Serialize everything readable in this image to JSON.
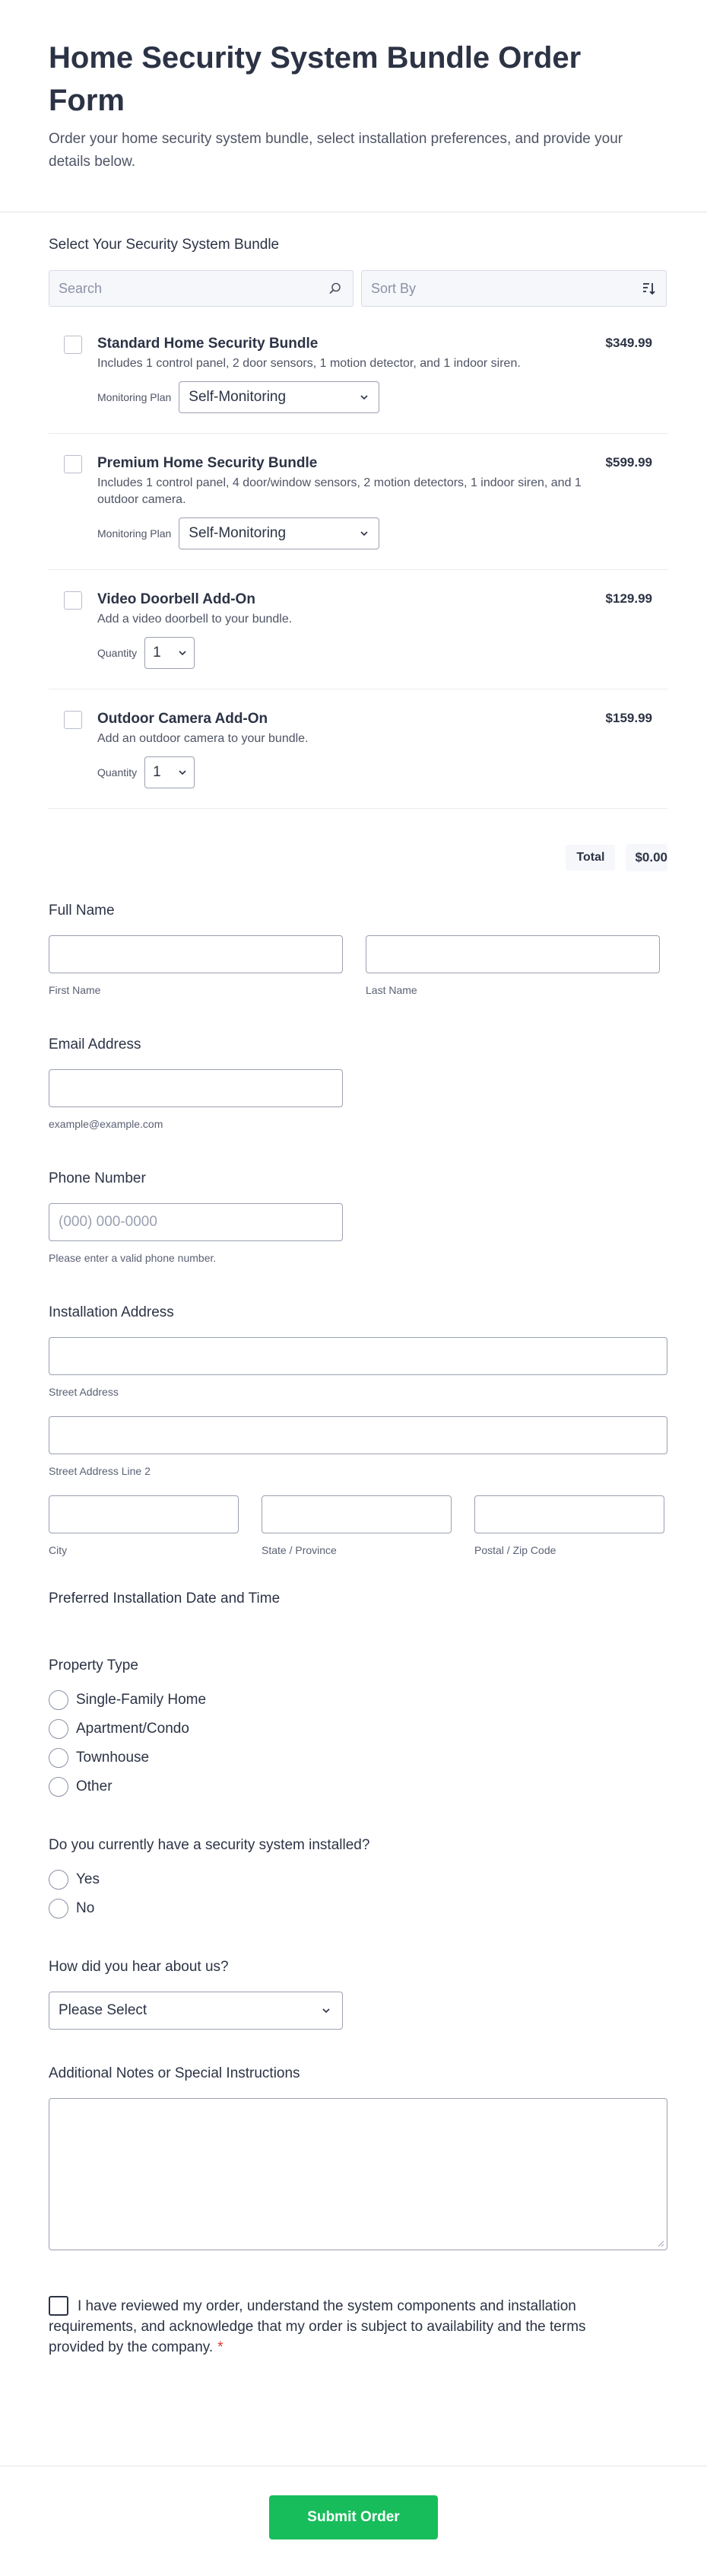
{
  "header": {
    "title": "Home Security System Bundle Order Form",
    "description": "Order your home security system bundle, select installation preferences, and provide your details below."
  },
  "products_section": {
    "label": "Select Your Security System Bundle",
    "search_placeholder": "Search",
    "sort_placeholder": "Sort By",
    "items": [
      {
        "title": "Standard Home Security Bundle",
        "description": "Includes 1 control panel, 2 door sensors, 1 motion detector, and 1 indoor siren.",
        "price": "$349.99",
        "option_label": "Monitoring Plan",
        "option_value": "Self-Monitoring"
      },
      {
        "title": "Premium Home Security Bundle",
        "description": "Includes 1 control panel, 4 door/window sensors, 2 motion detectors, 1 indoor siren, and 1 outdoor camera.",
        "price": "$599.99",
        "option_label": "Monitoring Plan",
        "option_value": "Self-Monitoring"
      },
      {
        "title": "Video Doorbell Add-On",
        "description": "Add a video doorbell to your bundle.",
        "price": "$129.99",
        "option_label": "Quantity",
        "option_value": "1"
      },
      {
        "title": "Outdoor Camera Add-On",
        "description": "Add an outdoor camera to your bundle.",
        "price": "$159.99",
        "option_label": "Quantity",
        "option_value": "1"
      }
    ],
    "total_label": "Total",
    "total_value": "$0.00"
  },
  "full_name": {
    "label": "Full Name",
    "first_sublabel": "First Name",
    "last_sublabel": "Last Name"
  },
  "email": {
    "label": "Email Address",
    "sublabel": "example@example.com"
  },
  "phone": {
    "label": "Phone Number",
    "placeholder": "(000) 000-0000",
    "sublabel": "Please enter a valid phone number."
  },
  "address": {
    "label": "Installation Address",
    "street_sublabel": "Street Address",
    "street2_sublabel": "Street Address Line 2",
    "city_sublabel": "City",
    "state_sublabel": "State / Province",
    "zip_sublabel": "Postal / Zip Code"
  },
  "installation_datetime": {
    "label": "Preferred Installation Date and Time"
  },
  "property_type": {
    "label": "Property Type",
    "options": [
      "Single-Family Home",
      "Apartment/Condo",
      "Townhouse",
      "Other"
    ]
  },
  "existing_system": {
    "label": "Do you currently have a security system installed?",
    "options": [
      "Yes",
      "No"
    ]
  },
  "referral": {
    "label": "How did you hear about us?",
    "selected": "Please Select"
  },
  "notes": {
    "label": "Additional Notes or Special Instructions"
  },
  "terms": {
    "text": "I have reviewed my order, understand the system components and installation requirements, and acknowledge that my order is subject to availability and the terms provided by the company.",
    "required_mark": "*"
  },
  "submit": {
    "label": "Submit Order",
    "color": "#18bd5b"
  }
}
